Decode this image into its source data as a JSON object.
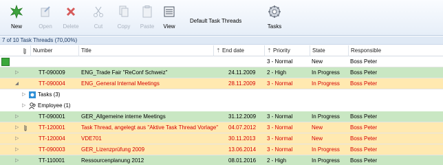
{
  "toolbar": {
    "new": "New",
    "open": "Open",
    "delete": "Delete",
    "cut": "Cut",
    "copy": "Copy",
    "paste": "Paste",
    "view": "View",
    "caption": "Default Task Threads",
    "tasks": "Tasks"
  },
  "status": "7 of 10 Task Threads (70,00%)",
  "columns": {
    "number": "Number",
    "title": "Title",
    "end_date": "End date",
    "priority": "Priority",
    "state": "State",
    "responsible": "Responsible"
  },
  "new_row": {
    "priority": "3 - Normal",
    "state": "New",
    "responsible": "Boss Peter"
  },
  "rows": [
    {
      "number": "TT-090009",
      "title": "ENG_Trade Fair \"ReConf Schweiz\"",
      "end_date": "24.11.2009",
      "priority": "2 - High",
      "state": "In Progress",
      "responsible": "Boss Peter"
    },
    {
      "number": "TT-090004",
      "title": "ENG_General Internal Meetings",
      "end_date": "28.11.2009",
      "priority": "3 - Normal",
      "state": "In Progress",
      "responsible": "Boss Peter"
    },
    {
      "number": "TT-090001",
      "title": "GER_Allgemeine interne Meetings",
      "end_date": "31.12.2009",
      "priority": "3 - Normal",
      "state": "In Progress",
      "responsible": "Boss Peter"
    },
    {
      "number": "TT-120001",
      "title": "Task Thread, angelegt aus \"Aktive Task Thread Vorlage\"",
      "end_date": "04.07.2012",
      "priority": "3 - Normal",
      "state": "New",
      "responsible": "Boss Peter"
    },
    {
      "number": "TT-120004",
      "title": "VDE701",
      "end_date": "30.11.2013",
      "priority": "3 - Normal",
      "state": "New",
      "responsible": "Boss Peter"
    },
    {
      "number": "TT-090003",
      "title": "GER_Lizenzprüfung 2009",
      "end_date": "13.06.2014",
      "priority": "3 - Normal",
      "state": "In Progress",
      "responsible": "Boss Peter"
    },
    {
      "number": "TT-110001",
      "title": "Ressourcenplanung 2012",
      "end_date": "08.01.2016",
      "priority": "2 - High",
      "state": "In Progress",
      "responsible": "Boss Peter"
    }
  ],
  "sub_items": {
    "tasks": "Tasks (3)",
    "employee": "Employee (1)"
  }
}
